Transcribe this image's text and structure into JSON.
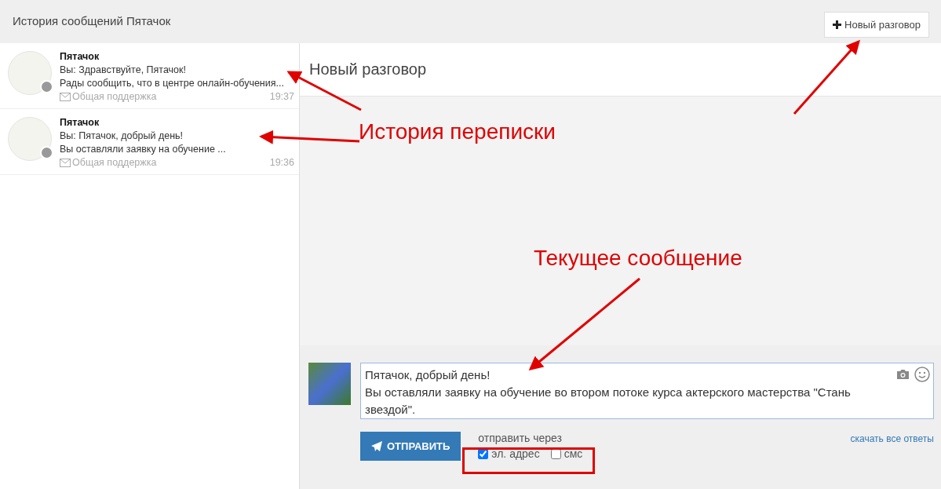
{
  "header": {
    "title": "История сообщений Пятачок",
    "new_conversation_button": "Новый разговор"
  },
  "conversations": [
    {
      "name": "Пятачок",
      "preview": "Вы: Здравствуйте, Пятачок!",
      "excerpt": "Рады сообщить, что в центре онлайн-обучения...",
      "channel": "Общая поддержка",
      "time": "19:37"
    },
    {
      "name": "Пятачок",
      "preview": "Вы: Пятачок, добрый день!",
      "excerpt": "Вы оставляли заявку на обучение ...",
      "channel": "Общая поддержка",
      "time": "19:36"
    }
  ],
  "panel": {
    "title": "Новый разговор"
  },
  "composer": {
    "message": "Пятачок, добрый день!\nВы оставляли заявку на обучение во втором потоке курса актерского мастерства \"Стань звездой\".",
    "send_button": "ОТПРАВИТЬ",
    "send_via_label": "отправить через",
    "channels": [
      {
        "label": "эл. адрес",
        "checked": true
      },
      {
        "label": "смс",
        "checked": false
      }
    ],
    "download_link": "скачать все ответы"
  },
  "annotations": [
    {
      "text": "История переписки"
    },
    {
      "text": "Текущее сообщение"
    }
  ]
}
